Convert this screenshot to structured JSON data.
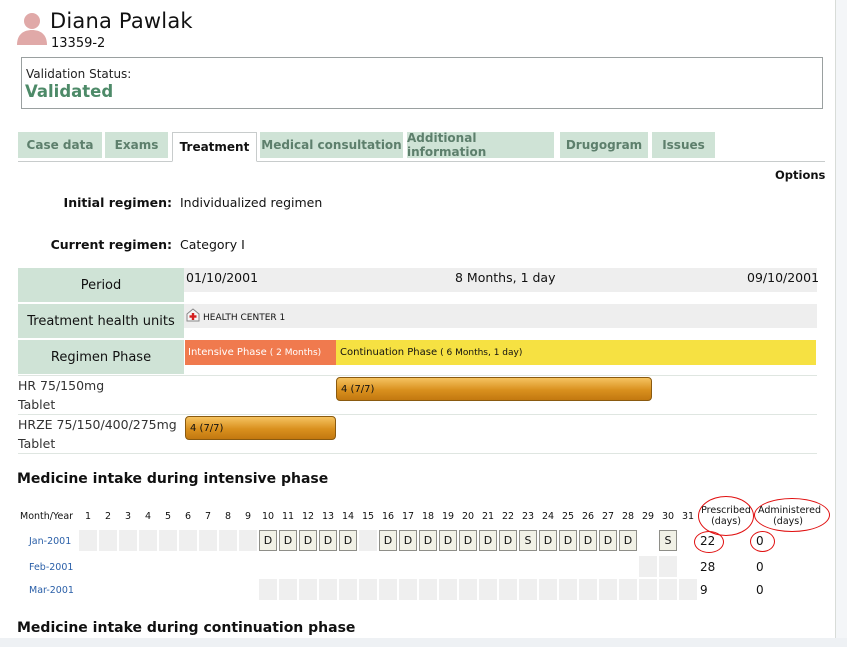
{
  "patient": {
    "name": "Diana Pawlak",
    "id": "13359-2"
  },
  "validation": {
    "label": "Validation Status:",
    "value": "Validated"
  },
  "tabs": [
    {
      "label": "Case data",
      "active": false
    },
    {
      "label": "Exams",
      "active": false
    },
    {
      "label": "Treatment",
      "active": true
    },
    {
      "label": "Medical consultation",
      "active": false
    },
    {
      "label": "Additional information",
      "active": false
    },
    {
      "label": "Drugogram",
      "active": false
    },
    {
      "label": "Issues",
      "active": false
    }
  ],
  "options_label": "Options",
  "regimen": {
    "initial_label": "Initial regimen:",
    "initial_value": "Individualized regimen",
    "current_label": "Current regimen:",
    "current_value": "Category I"
  },
  "timeline": {
    "period_label": "Period",
    "period_start": "01/10/2001",
    "period_duration": "8 Months, 1 day",
    "period_end": "09/10/2001",
    "health_units_label": "Treatment health units",
    "health_unit": "HEALTH CENTER 1",
    "regimen_phase_label": "Regimen Phase",
    "intensive_phase": {
      "name": "Intensive Phase",
      "duration": "( 2 Months)"
    },
    "continuation_phase": {
      "name": "Continuation Phase",
      "duration": "( 6 Months, 1 day)"
    },
    "medicines": [
      {
        "name_line1": "HR 75/150mg",
        "name_line2": "Tablet",
        "bar_label": "4 (7/7)"
      },
      {
        "name_line1": "HRZE 75/150/400/275mg",
        "name_line2": "Tablet",
        "bar_label": "4 (7/7)"
      }
    ]
  },
  "intake_intensive": {
    "title": "Medicine intake during intensive phase",
    "month_year_label": "Month/Year",
    "days": [
      "1",
      "2",
      "3",
      "4",
      "5",
      "6",
      "7",
      "8",
      "9",
      "10",
      "11",
      "12",
      "13",
      "14",
      "15",
      "16",
      "17",
      "18",
      "19",
      "20",
      "21",
      "22",
      "23",
      "24",
      "25",
      "26",
      "27",
      "28",
      "29",
      "30",
      "31"
    ],
    "prescribed_label_1": "Prescribed",
    "prescribed_label_2": "(days)",
    "administered_label_1": "Administered",
    "administered_label_2": "(days)",
    "rows": [
      {
        "month": "Jan-2001",
        "marks": {
          "10": "D",
          "11": "D",
          "12": "D",
          "13": "D",
          "14": "D",
          "16": "D",
          "17": "D",
          "18": "D",
          "19": "D",
          "20": "D",
          "21": "D",
          "22": "D",
          "23": "S",
          "24": "D",
          "25": "D",
          "26": "D",
          "27": "D",
          "28": "D",
          "30": "S"
        },
        "prescribed": "22",
        "administered": "0"
      },
      {
        "month": "Feb-2001",
        "marks": {},
        "prescribed": "28",
        "administered": "0"
      },
      {
        "month": "Mar-2001",
        "marks": {},
        "prescribed": "9",
        "administered": "0"
      }
    ]
  },
  "intake_continuation": {
    "title": "Medicine intake during continuation phase"
  },
  "colors": {
    "validated": "#4d8a68",
    "tab_bg": "#cfe3d6",
    "intensive": "#f07a4e",
    "continuation": "#f6e142",
    "annotation": "#e01010"
  }
}
